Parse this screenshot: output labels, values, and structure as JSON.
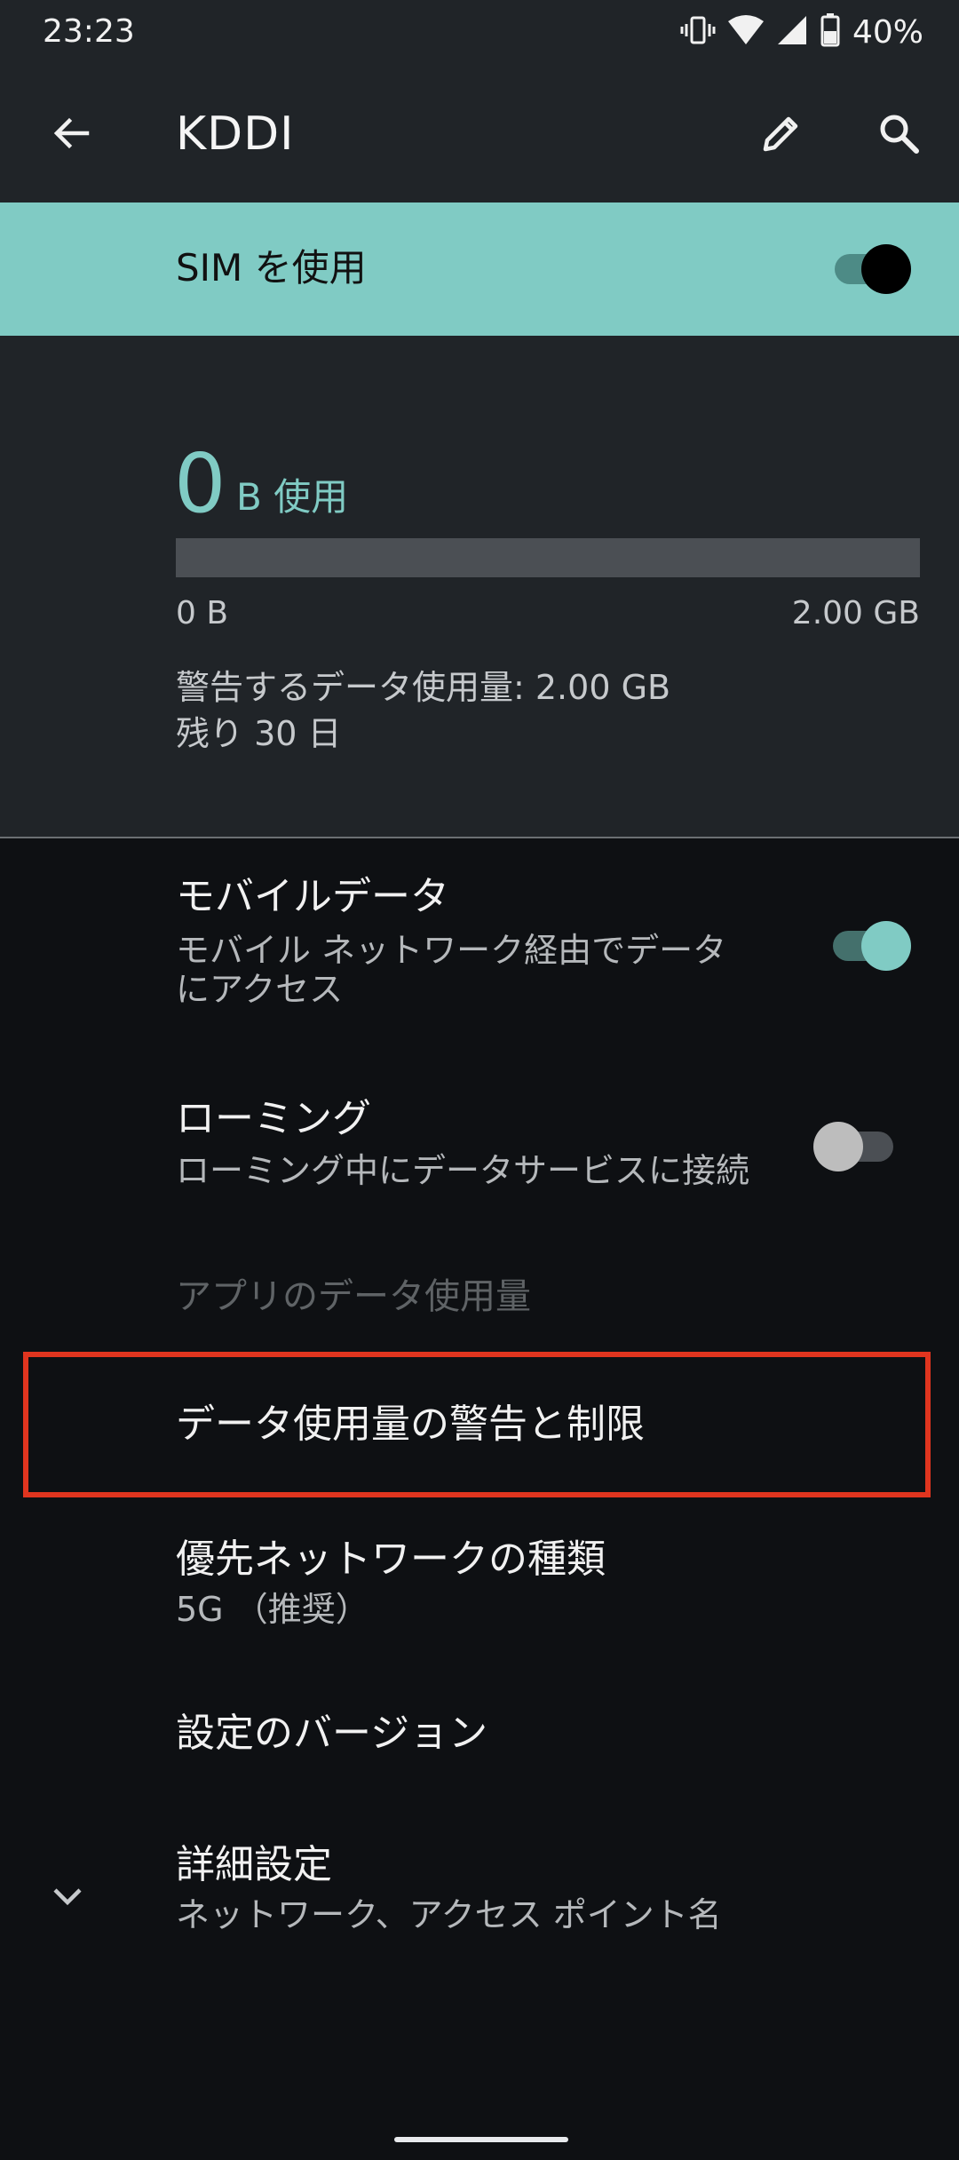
{
  "status_bar": {
    "time": "23:23",
    "battery_percent": "40%",
    "icons": [
      "vibrate-icon",
      "wifi-icon",
      "signal-icon",
      "battery-icon"
    ]
  },
  "toolbar": {
    "title": "KDDI",
    "back_icon": "back-arrow-icon",
    "edit_icon": "pencil-icon",
    "search_icon": "search-icon"
  },
  "sim": {
    "label": "SIM を使用",
    "enabled": true
  },
  "usage": {
    "amount": "0",
    "unit_label": "B 使用",
    "bar_fraction": 0,
    "min_label": "0 B",
    "max_label": "2.00 GB",
    "warning_text": "警告するデータ使用量: 2.00 GB",
    "remaining_text": "残り 30 日"
  },
  "settings": {
    "mobile_data": {
      "title": "モバイルデータ",
      "subtitle_line1": "モバイル ネットワーク経由でデータ",
      "subtitle_line2": "にアクセス",
      "enabled": true
    },
    "roaming": {
      "title": "ローミング",
      "subtitle": "ローミング中にデータサービスに接続",
      "enabled": false
    },
    "app_data_usage_header": "アプリのデータ使用量",
    "data_warning_limit": {
      "title": "データ使用量の警告と制限"
    },
    "preferred_network": {
      "title": "優先ネットワークの種類",
      "subtitle": "5G （推奨）"
    },
    "config_version": {
      "title": "設定のバージョン"
    },
    "advanced": {
      "title": "詳細設定",
      "subtitle": "ネットワーク、アクセス ポイント名",
      "icon": "chevron-down-icon"
    }
  },
  "colors": {
    "accent": "#80cbc4",
    "background": "#0e1013",
    "card": "#202428",
    "highlight": "#e0351f"
  }
}
